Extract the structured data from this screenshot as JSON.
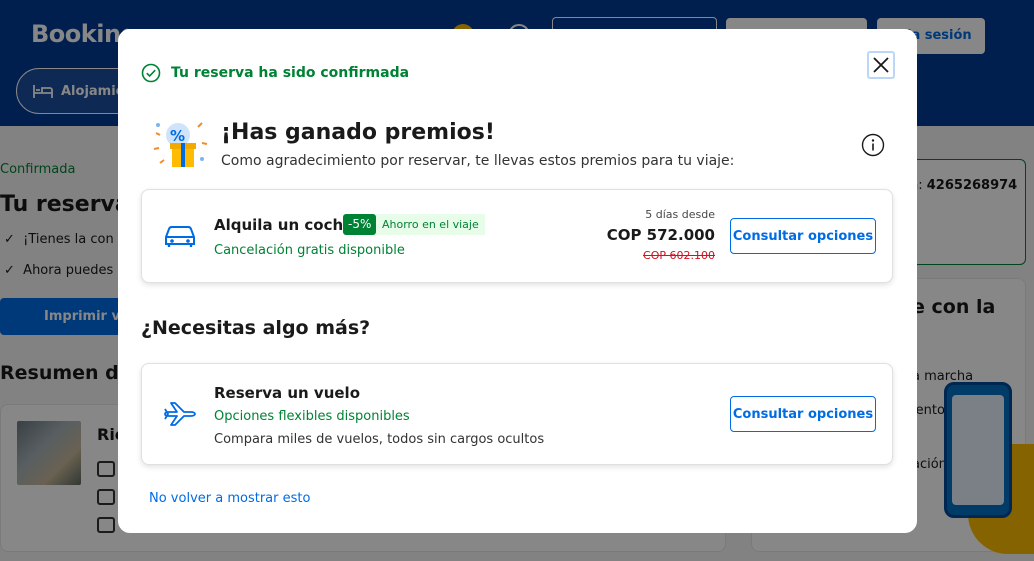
{
  "background": {
    "logo": "Booking",
    "login_label": "la sesión",
    "search_pill_label": "Alojamie",
    "status": "Confirmada",
    "title_partial": "Tu reserva",
    "check_1": "¡Tienes la con",
    "check_2": "Ahora puedes",
    "print_label": "Imprimir ve",
    "summary_title": "Resumen de",
    "hotel_partial": "Ric",
    "booking_number_label": "n:",
    "booking_number": "4265268974",
    "app_title_partial": "e con la",
    "app_line_1": "a marcha",
    "app_line_2": "iento en",
    "app_line_3": "ación offline"
  },
  "modal": {
    "confirmation": "Tu reserva ha sido confirmada",
    "prizes_title": "¡Has ganado premios!",
    "prizes_subtitle": "Como agradecimiento por reservar, te llevas estos premios para tu viaje:",
    "car": {
      "title": "Alquila un coche",
      "discount": "-5%",
      "saving": "Ahorro en el viaje",
      "cancellation": "Cancelación gratis disponible",
      "days_from": "5 días desde",
      "price": "COP 572.000",
      "old_price": "COP 602.100",
      "button": "Consultar opciones"
    },
    "need_more": "¿Necesitas algo más?",
    "flight": {
      "title": "Reserva un vuelo",
      "flexible": "Opciones flexibles disponibles",
      "description": "Compara miles de vuelos, todos sin cargos ocultos",
      "button": "Consultar opciones"
    },
    "dont_show": "No volver a mostrar esto"
  },
  "colors": {
    "brand_blue": "#003b95",
    "action_blue": "#006ce4",
    "success_green": "#008234",
    "strike_red": "#d4111e"
  }
}
